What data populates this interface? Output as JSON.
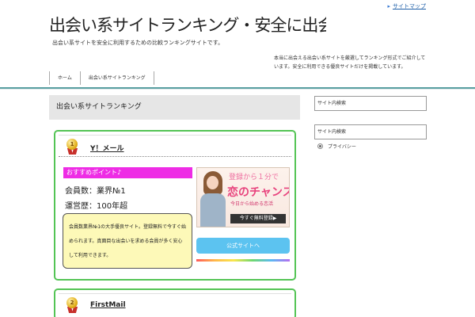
{
  "header": {
    "sitemap_label": "サイトマップ",
    "title": "出会い系サイトランキング・安全に出会える出会い系アプリ比較",
    "description": "出会い系サイトを安全に利用するための比較ランキングサイトです。",
    "right_text": "本当に出会える出会い系サイトを厳選してランキング形式でご紹介しています。安全に利用できる優良サイトだけを掲載しています。"
  },
  "nav": {
    "items": [
      {
        "label": "ホーム"
      },
      {
        "label": "出会い系サイトランキング"
      }
    ]
  },
  "main": {
    "heading": "出会い系サイトランキング"
  },
  "sidebar": {
    "search1": "サイト内検索",
    "search2": "サイト内検索",
    "link1": "プライバシー"
  },
  "ranking": [
    {
      "rank": "1",
      "name": "Y！メール",
      "badge": "おすすめポイント♪",
      "info1": "会員数：業界№1",
      "info2": "運営歴：100年超",
      "description": "会員数業界№1の大手優良サイト。登録無料で今すぐ始められます。真面目な出会いを求める会員が多く安心して利用できます。",
      "banner": {
        "line1": "登録から１分で",
        "line2": "恋のチャンス",
        "line3": "今日から始める恋活",
        "cta": "今すぐ無料登録▶"
      },
      "button_label": "公式サイトへ"
    },
    {
      "rank": "2",
      "name": "FirstMail"
    }
  ],
  "colors": {
    "accent_teal": "#5a9fa2",
    "card_border": "#54c455",
    "badge_pink": "#ee2ce5",
    "button_blue": "#5cc3f0",
    "note_yellow": "#fdf9b8"
  },
  "icons": [
    "triangle-right-icon",
    "gold-medal-icon",
    "radio-dot-icon"
  ]
}
